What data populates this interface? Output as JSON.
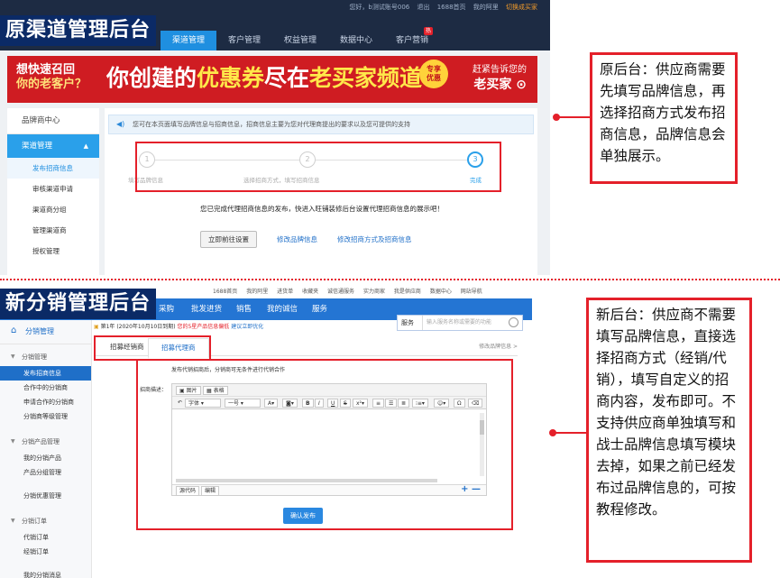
{
  "old": {
    "title": "原渠道管理后台",
    "toplinks": [
      "您好，b测试账号006",
      "退出",
      "1688首页",
      "我的阿里",
      "切换成买家"
    ],
    "nav": [
      {
        "label": "渠道管理",
        "active": true
      },
      {
        "label": "客户管理"
      },
      {
        "label": "权益管理"
      },
      {
        "label": "数据中心"
      },
      {
        "label": "客户营销",
        "badge": "热"
      }
    ],
    "banner": {
      "left_line1": "想快速召回",
      "left_line2": "你的老客户？",
      "main_a": "你创建的",
      "main_b": "优惠券",
      "main_c": "尽在",
      "main_d": "老买家频道",
      "badge_line1": "专享",
      "badge_line2": "优惠",
      "right_line1": "赶紧告诉您的",
      "right_line2": "老买家"
    },
    "sidebar": {
      "head": "品牌商中心",
      "group": "渠道管理",
      "items": [
        "发布招商信息",
        "审核渠道申请",
        "渠道商分组",
        "管理渠道商",
        "授权管理"
      ]
    },
    "info": "您可在本页面填写品牌信息与招商信息，招商信息主要为您对代理商提出的要求以及您可提供的支持",
    "steps": [
      {
        "num": "1",
        "label": "填写品牌信息"
      },
      {
        "num": "2",
        "label": "选择招商方式，填写招商信息"
      },
      {
        "num": "3",
        "label": "完成"
      }
    ],
    "done_message": "您已完成代理招商信息的发布，快进入旺铺装修后台设置代理招商信息的展示吧！",
    "actions": {
      "button": "立即前往设置",
      "link1": "修改品牌信息",
      "link2": "修改招商方式及招商信息"
    },
    "note": "原后台：供应商需要先填写品牌信息，再选择招商方式发布招商信息，品牌信息会单独展示。"
  },
  "new": {
    "title": "新分销管理后台",
    "toplinks": [
      "1688首页",
      "我的阿里",
      "进货单",
      "收藏夹",
      "诚信通服务",
      "实力商家",
      "我是供应商",
      "数据中心",
      "网站导航"
    ],
    "nav": [
      "采购",
      "批发进货",
      "销售",
      "我的诚信",
      "服务"
    ],
    "search": {
      "select": "服务",
      "placeholder": "输入服务名称或需要的功能"
    },
    "sidebar": {
      "home": "分销管理",
      "groups": [
        {
          "label": "分销管理",
          "items": [
            "发布招商信息",
            "合作中的分销商",
            "申请合作的分销商",
            "分销商等级管理"
          ]
        },
        {
          "label": "分销产品管理",
          "items": [
            "我的分销产品",
            "产品分组管理"
          ]
        },
        {
          "label": "",
          "items": [
            "分销优惠管理"
          ]
        },
        {
          "label": "分销订单",
          "items": [
            "代销订单",
            "经销订单"
          ]
        },
        {
          "label": "",
          "items": [
            "我的分销消息"
          ]
        }
      ]
    },
    "notice_a": "第1年 (2020年10月10日到期)",
    "notice_b": "您的5星产品信息偏低",
    "notice_c": "建议立即优化",
    "tabs": [
      "招募经销商",
      "招募代理商"
    ],
    "tabs_right": "修改品牌信息 >",
    "form_hint": "发布代销招商后，分销商可无条件进行代销合作",
    "form_label": "招商描述：",
    "editor": {
      "tb1": [
        "图片",
        "表格"
      ],
      "font": "字体",
      "size": "一号",
      "foot_tabs": [
        "源代码",
        "编辑"
      ],
      "plusminus": "+ —"
    },
    "publish": "确认发布",
    "note": "新后台：供应商不需要填写品牌信息，直接选择招商方式（经销/代销），填写自定义的招商内容，发布即可。不支持供应商单独填写和战士品牌信息填写模块去掉，如果之前已经发布过品牌信息的，可按教程修改。"
  },
  "colors": {
    "accent_red": "#e4202a",
    "title_bg": "#0b2a66",
    "old_nav_active": "#1f8fe0",
    "new_bar": "#2475d3"
  }
}
